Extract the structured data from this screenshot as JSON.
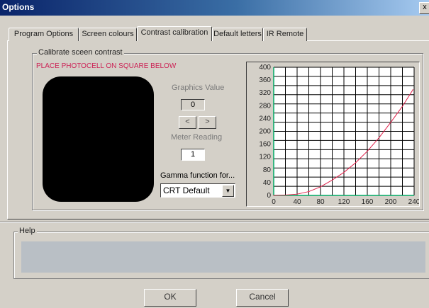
{
  "window": {
    "title": "Options",
    "close_label": "x"
  },
  "tabs": [
    {
      "label": "Program Options"
    },
    {
      "label": "Screen colours"
    },
    {
      "label": "Contrast calibration"
    },
    {
      "label": "Default letters"
    },
    {
      "label": "IR Remote"
    }
  ],
  "active_tab": 2,
  "calibrate": {
    "group_title": "Calibrate sceen contrast",
    "instruction": "PLACE PHOTOCELL ON SQUARE BELOW",
    "graphics_label": "Graphics Value",
    "graphics_value": "0",
    "decrease_label": "<",
    "increase_label": ">",
    "meter_label": "Meter Reading",
    "meter_value": "1",
    "gamma_label": "Gamma function for...",
    "gamma_selected": "CRT Default"
  },
  "help": {
    "title": "Help"
  },
  "buttons": {
    "ok": "OK",
    "cancel": "Cancel"
  },
  "colors": {
    "curve": "#e0204a",
    "axis": "#00aa66",
    "instruction": "#cc2255"
  },
  "chart_data": {
    "type": "line",
    "xlim": [
      0,
      240
    ],
    "ylim": [
      0,
      400
    ],
    "xticks": [
      "0",
      "40",
      "80",
      "120",
      "160",
      "200",
      "240"
    ],
    "yticks": [
      "0",
      "40",
      "80",
      "120",
      "160",
      "200",
      "240",
      "280",
      "320",
      "360",
      "400"
    ],
    "grid": true,
    "series": [
      {
        "x": [
          0,
          20,
          40,
          60,
          80,
          100,
          120,
          140,
          160,
          180,
          200,
          220,
          238
        ],
        "values": [
          0,
          1,
          4,
          12,
          27,
          48,
          72,
          102,
          138,
          180,
          228,
          278,
          330
        ]
      }
    ]
  }
}
